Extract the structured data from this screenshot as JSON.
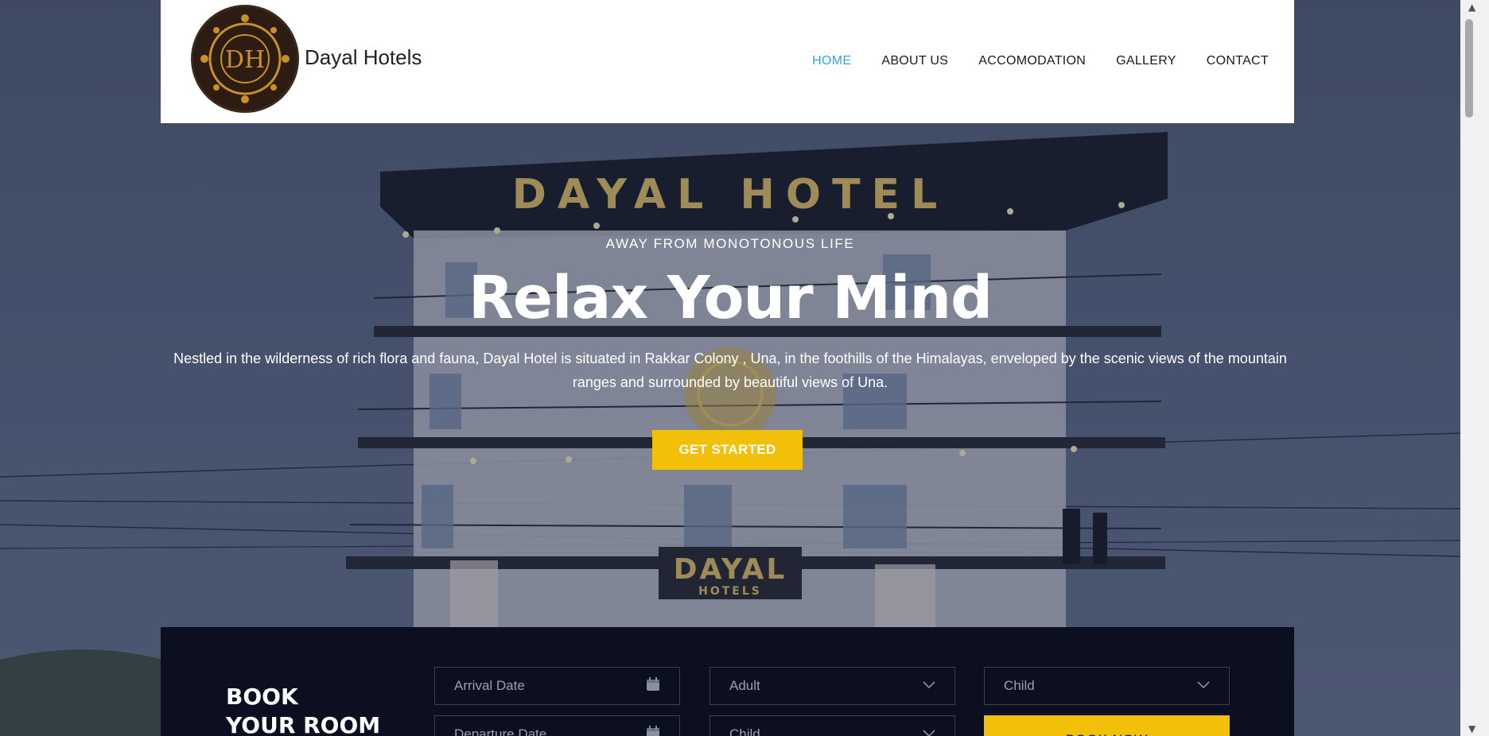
{
  "header": {
    "brand": "Dayal Hotels",
    "logo_text": "DH",
    "nav": [
      {
        "label": "HOME",
        "active": true
      },
      {
        "label": "ABOUT US",
        "active": false
      },
      {
        "label": "ACCOMODATION",
        "active": false
      },
      {
        "label": "GALLERY",
        "active": false
      },
      {
        "label": "CONTACT",
        "active": false
      }
    ]
  },
  "hero": {
    "kicker": "AWAY FROM MONOTONOUS LIFE",
    "headline": "Relax Your Mind",
    "lead": "Nestled in the wilderness of rich flora and fauna, Dayal Hotel is situated in Rakkar Colony , Una, in the foothills of the Himalayas, enveloped by the scenic views of the mountain ranges and surrounded by beautiful views of Una.",
    "cta_label": "GET STARTED",
    "sign_top": "DAYAL HOTEL",
    "sign_bottom": "DAYAL",
    "sign_bottom_sub": "HOTELS"
  },
  "booking": {
    "title_line1": "BOOK",
    "title_line2": "YOUR ROOM",
    "arrival_placeholder": "Arrival Date",
    "departure_placeholder": "Departure Date",
    "adult_select": "Adult",
    "child_select_1": "Child",
    "child_select_2": "Child",
    "book_label": "BOOK NOW"
  },
  "colors": {
    "accent": "#f2c008",
    "nav_active": "#2aa7df",
    "booking_bg": "#0b0f1f"
  },
  "icons": [
    "calendar-icon",
    "chevron-down-icon",
    "scroll-up-arrow",
    "scroll-down-arrow"
  ]
}
